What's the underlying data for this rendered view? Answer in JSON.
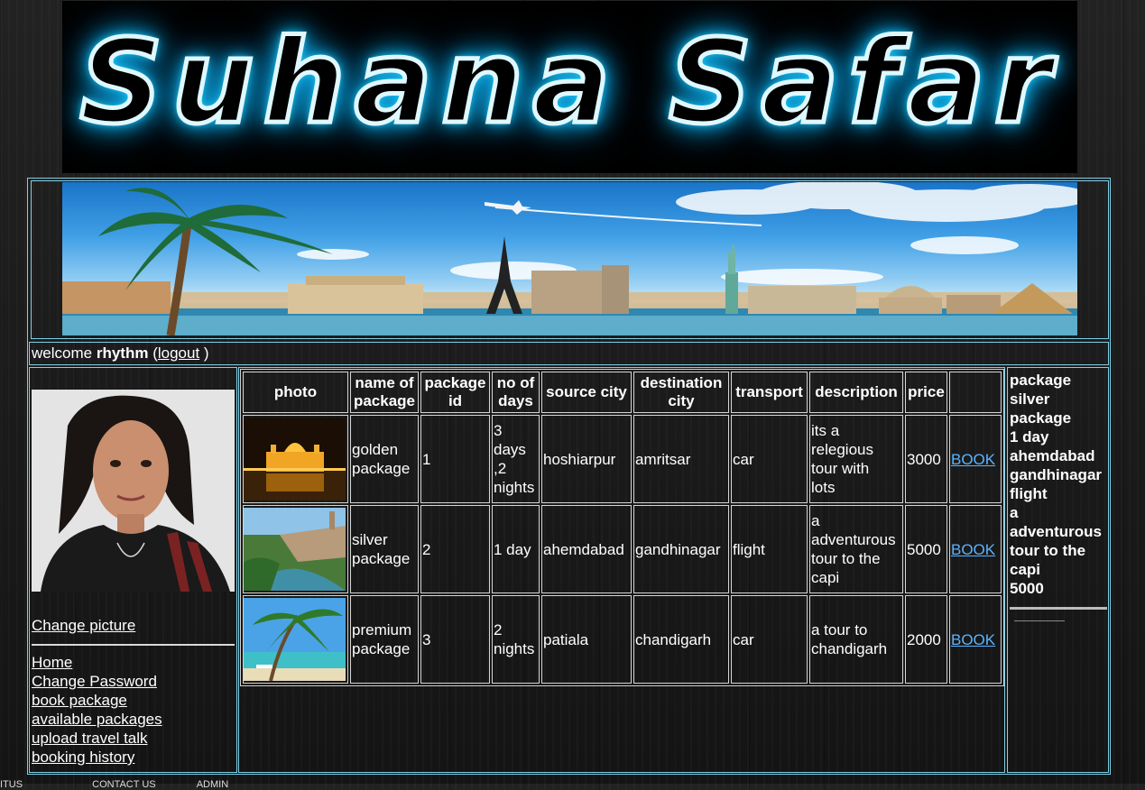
{
  "header": {
    "logo_text": "Suhana Safar"
  },
  "welcome": {
    "prefix": "welcome",
    "username": "rhythm",
    "open_paren": "(",
    "logout": "logout",
    "close_paren": ")"
  },
  "sidebar": {
    "change_picture": "Change picture",
    "nav": [
      "Home",
      "Change Password",
      "book package",
      "available packages",
      "upload travel talk",
      "booking history"
    ]
  },
  "table": {
    "headers": {
      "photo": "photo",
      "name": [
        "name of",
        "package"
      ],
      "id": [
        "package",
        "id"
      ],
      "days": [
        "no of",
        "days"
      ],
      "source": "source city",
      "destination": [
        "destination",
        "city"
      ],
      "transport": "transport",
      "description": "description",
      "price": "price"
    },
    "rows": [
      {
        "name": [
          "golden",
          "package"
        ],
        "id": "1",
        "days": [
          "3",
          "days",
          ",2",
          "nights"
        ],
        "source": "hoshiarpur",
        "destination": "amritsar",
        "transport": "car",
        "description": [
          "its a",
          "relegious",
          "tour with",
          "lots"
        ],
        "price": "3000",
        "action": "BOOK"
      },
      {
        "name": [
          "silver",
          "package"
        ],
        "id": "2",
        "days": [
          "1 day"
        ],
        "source": "ahemdabad",
        "destination": "gandhinagar",
        "transport": "flight",
        "description": [
          "a",
          "adventurous",
          "tour to the",
          "capi"
        ],
        "price": "5000",
        "action": "BOOK"
      },
      {
        "name": [
          "premium",
          "package"
        ],
        "id": "3",
        "days": [
          "2",
          "nights"
        ],
        "source": "patiala",
        "destination": "chandigarh",
        "transport": "car",
        "description": [
          "a tour to",
          "chandigarh"
        ],
        "price": "2000",
        "action": "BOOK"
      }
    ]
  },
  "right_panel": [
    "package",
    "silver",
    "package",
    "1 day",
    "ahemdabad",
    "gandhinagar",
    "flight",
    "a",
    "adventurous",
    "tour to the",
    "capi",
    "5000"
  ],
  "footer": [
    "ITUS",
    "CONTACT US",
    "ADMIN"
  ],
  "colors": {
    "border": "#7fd0e8",
    "link_book": "#59b4ff",
    "logo_glow": "#2ed8ff"
  }
}
